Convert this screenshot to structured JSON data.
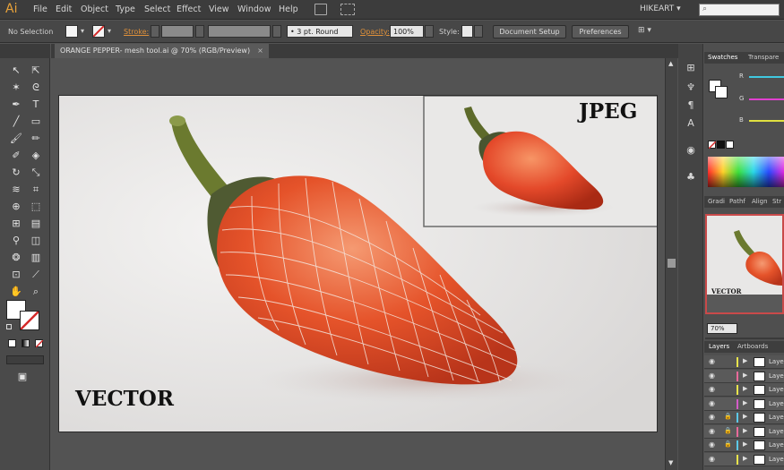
{
  "menubar": {
    "logo": "Ai",
    "items": [
      "File",
      "Edit",
      "Object",
      "Type",
      "Select",
      "Effect",
      "View",
      "Window",
      "Help"
    ],
    "user": "HIKEART",
    "user_caret": "▾"
  },
  "controlbar": {
    "selection": "No Selection",
    "stroke_label": "Stroke:",
    "stroke_profile": "3 pt. Round",
    "opacity_label": "Opacity:",
    "opacity_value": "100%",
    "style_label": "Style:",
    "document_setup": "Document Setup",
    "preferences": "Preferences"
  },
  "document": {
    "tab_title": "ORANGE PEPPER- mesh tool.ai @ 70% (RGB/Preview)",
    "close": "×",
    "vector_label": "VECTOR",
    "jpeg_label": "JPEG"
  },
  "right_panel": {
    "top_tabs": [
      "Swatches",
      "Transpare"
    ],
    "color_channels": [
      "R",
      "G",
      "B"
    ],
    "mid_tabs": [
      "Gradi",
      "Pathf",
      "Align",
      "Str"
    ],
    "navigator_label": "VECTOR",
    "zoom": "70%",
    "layer_tabs": [
      "Layers",
      "Artboards"
    ],
    "layers": [
      {
        "name": "Laye",
        "locked": false,
        "color": "#e8e44c"
      },
      {
        "name": "Laye",
        "locked": false,
        "color": "#e86a9a"
      },
      {
        "name": "Laye",
        "locked": false,
        "color": "#e8e44c"
      },
      {
        "name": "Laye",
        "locked": false,
        "color": "#d45cc8"
      },
      {
        "name": "Laye",
        "locked": true,
        "color": "#5cc8e8"
      },
      {
        "name": "Laye",
        "locked": true,
        "color": "#e86a9a"
      },
      {
        "name": "Laye",
        "locked": true,
        "color": "#5cc8e8"
      },
      {
        "name": "Laye",
        "locked": false,
        "color": "#e8e44c"
      }
    ]
  },
  "colors": {
    "accent": "#e0913a",
    "pepper": "#e5532a",
    "stem": "#6b7a2f"
  }
}
